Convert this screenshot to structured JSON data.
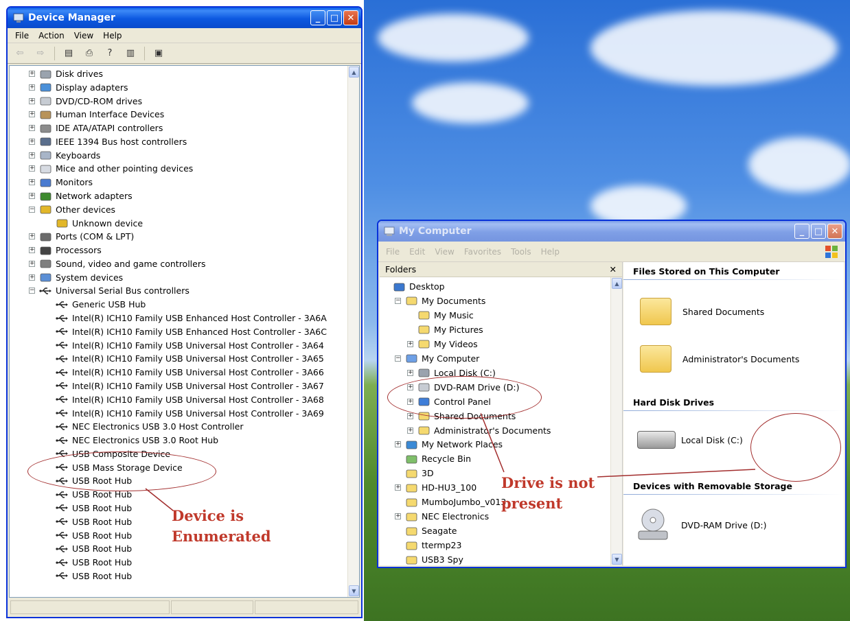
{
  "device_manager": {
    "title": "Device Manager",
    "menu": [
      "File",
      "Action",
      "View",
      "Help"
    ],
    "tree": [
      {
        "label": "Disk drives",
        "level": 0,
        "expander": "+",
        "icon": "disk-drive-icon"
      },
      {
        "label": "Display adapters",
        "level": 0,
        "expander": "+",
        "icon": "display-adapter-icon"
      },
      {
        "label": "DVD/CD-ROM drives",
        "level": 0,
        "expander": "+",
        "icon": "dvd-drive-icon"
      },
      {
        "label": "Human Interface Devices",
        "level": 0,
        "expander": "+",
        "icon": "hid-icon"
      },
      {
        "label": "IDE ATA/ATAPI controllers",
        "level": 0,
        "expander": "+",
        "icon": "ide-controller-icon"
      },
      {
        "label": "IEEE 1394 Bus host controllers",
        "level": 0,
        "expander": "+",
        "icon": "firewire-icon"
      },
      {
        "label": "Keyboards",
        "level": 0,
        "expander": "+",
        "icon": "keyboard-icon"
      },
      {
        "label": "Mice and other pointing devices",
        "level": 0,
        "expander": "+",
        "icon": "mouse-icon"
      },
      {
        "label": "Monitors",
        "level": 0,
        "expander": "+",
        "icon": "monitor-icon"
      },
      {
        "label": "Network adapters",
        "level": 0,
        "expander": "+",
        "icon": "network-adapter-icon"
      },
      {
        "label": "Other devices",
        "level": 0,
        "expander": "-",
        "icon": "unknown-device-icon"
      },
      {
        "label": "Unknown device",
        "level": 1,
        "expander": "",
        "icon": "unknown-device-icon"
      },
      {
        "label": "Ports (COM & LPT)",
        "level": 0,
        "expander": "+",
        "icon": "port-icon"
      },
      {
        "label": "Processors",
        "level": 0,
        "expander": "+",
        "icon": "processor-icon"
      },
      {
        "label": "Sound, video and game controllers",
        "level": 0,
        "expander": "+",
        "icon": "sound-icon"
      },
      {
        "label": "System devices",
        "level": 0,
        "expander": "+",
        "icon": "system-device-icon"
      },
      {
        "label": "Universal Serial Bus controllers",
        "level": 0,
        "expander": "-",
        "icon": "usb-icon"
      },
      {
        "label": "Generic USB Hub",
        "level": 1,
        "expander": "",
        "icon": "usb-icon"
      },
      {
        "label": "Intel(R) ICH10 Family USB Enhanced Host Controller - 3A6A",
        "level": 1,
        "expander": "",
        "icon": "usb-icon"
      },
      {
        "label": "Intel(R) ICH10 Family USB Enhanced Host Controller - 3A6C",
        "level": 1,
        "expander": "",
        "icon": "usb-icon"
      },
      {
        "label": "Intel(R) ICH10 Family USB Universal Host Controller - 3A64",
        "level": 1,
        "expander": "",
        "icon": "usb-icon"
      },
      {
        "label": "Intel(R) ICH10 Family USB Universal Host Controller - 3A65",
        "level": 1,
        "expander": "",
        "icon": "usb-icon"
      },
      {
        "label": "Intel(R) ICH10 Family USB Universal Host Controller - 3A66",
        "level": 1,
        "expander": "",
        "icon": "usb-icon"
      },
      {
        "label": "Intel(R) ICH10 Family USB Universal Host Controller - 3A67",
        "level": 1,
        "expander": "",
        "icon": "usb-icon"
      },
      {
        "label": "Intel(R) ICH10 Family USB Universal Host Controller - 3A68",
        "level": 1,
        "expander": "",
        "icon": "usb-icon"
      },
      {
        "label": "Intel(R) ICH10 Family USB Universal Host Controller - 3A69",
        "level": 1,
        "expander": "",
        "icon": "usb-icon"
      },
      {
        "label": "NEC Electronics USB 3.0 Host Controller",
        "level": 1,
        "expander": "",
        "icon": "usb-icon"
      },
      {
        "label": "NEC Electronics USB 3.0 Root Hub",
        "level": 1,
        "expander": "",
        "icon": "usb-icon"
      },
      {
        "label": "USB Composite Device",
        "level": 1,
        "expander": "",
        "icon": "usb-icon"
      },
      {
        "label": "USB Mass Storage Device",
        "level": 1,
        "expander": "",
        "icon": "usb-icon"
      },
      {
        "label": "USB Root Hub",
        "level": 1,
        "expander": "",
        "icon": "usb-icon"
      },
      {
        "label": "USB Root Hub",
        "level": 1,
        "expander": "",
        "icon": "usb-icon"
      },
      {
        "label": "USB Root Hub",
        "level": 1,
        "expander": "",
        "icon": "usb-icon"
      },
      {
        "label": "USB Root Hub",
        "level": 1,
        "expander": "",
        "icon": "usb-icon"
      },
      {
        "label": "USB Root Hub",
        "level": 1,
        "expander": "",
        "icon": "usb-icon"
      },
      {
        "label": "USB Root Hub",
        "level": 1,
        "expander": "",
        "icon": "usb-icon"
      },
      {
        "label": "USB Root Hub",
        "level": 1,
        "expander": "",
        "icon": "usb-icon"
      },
      {
        "label": "USB Root Hub",
        "level": 1,
        "expander": "",
        "icon": "usb-icon"
      }
    ]
  },
  "my_computer": {
    "title": "My Computer",
    "menu": [
      "File",
      "Edit",
      "View",
      "Favorites",
      "Tools",
      "Help"
    ],
    "folders_label": "Folders",
    "close_glyph": "✕",
    "tree": [
      {
        "label": "Desktop",
        "level": 0,
        "expander": "",
        "icon": "desktop-icon"
      },
      {
        "label": "My Documents",
        "level": 1,
        "expander": "-",
        "icon": "folder-icon"
      },
      {
        "label": "My Music",
        "level": 2,
        "expander": "",
        "icon": "music-folder-icon"
      },
      {
        "label": "My Pictures",
        "level": 2,
        "expander": "",
        "icon": "pictures-folder-icon"
      },
      {
        "label": "My Videos",
        "level": 2,
        "expander": "+",
        "icon": "videos-folder-icon"
      },
      {
        "label": "My Computer",
        "level": 1,
        "expander": "-",
        "icon": "computer-icon"
      },
      {
        "label": "Local Disk (C:)",
        "level": 2,
        "expander": "+",
        "icon": "disk-drive-icon"
      },
      {
        "label": "DVD-RAM Drive (D:)",
        "level": 2,
        "expander": "+",
        "icon": "dvd-drive-icon"
      },
      {
        "label": "Control Panel",
        "level": 2,
        "expander": "+",
        "icon": "control-panel-icon"
      },
      {
        "label": "Shared Documents",
        "level": 2,
        "expander": "+",
        "icon": "folder-icon"
      },
      {
        "label": "Administrator's Documents",
        "level": 2,
        "expander": "+",
        "icon": "folder-icon"
      },
      {
        "label": "My Network Places",
        "level": 1,
        "expander": "+",
        "icon": "network-places-icon"
      },
      {
        "label": "Recycle Bin",
        "level": 1,
        "expander": "",
        "icon": "recycle-bin-icon"
      },
      {
        "label": "3D",
        "level": 1,
        "expander": "",
        "icon": "folder-icon"
      },
      {
        "label": "HD-HU3_100",
        "level": 1,
        "expander": "+",
        "icon": "folder-icon"
      },
      {
        "label": "MumboJumbo_v013",
        "level": 1,
        "expander": "",
        "icon": "folder-icon"
      },
      {
        "label": "NEC Electronics",
        "level": 1,
        "expander": "+",
        "icon": "folder-icon"
      },
      {
        "label": "Seagate",
        "level": 1,
        "expander": "",
        "icon": "folder-icon"
      },
      {
        "label": "ttermp23",
        "level": 1,
        "expander": "",
        "icon": "folder-icon"
      },
      {
        "label": "USB3 Spy",
        "level": 1,
        "expander": "",
        "icon": "folder-icon"
      }
    ],
    "groups": {
      "files_stored": "Files Stored on This Computer",
      "hard_disks": "Hard Disk Drives",
      "removable": "Devices with Removable Storage"
    },
    "items": {
      "shared_documents": "Shared Documents",
      "admin_documents": "Administrator's Documents",
      "local_disk": "Local Disk (C:)",
      "dvd_drive": "DVD-RAM Drive (D:)"
    }
  },
  "annotations": {
    "device_enumerated": [
      "Device is",
      "Enumerated"
    ],
    "drive_not_present": [
      "Drive is not",
      "present"
    ]
  },
  "colors": {
    "annotation": "#c0392b",
    "xp_title_blue": "#0a58e0"
  }
}
